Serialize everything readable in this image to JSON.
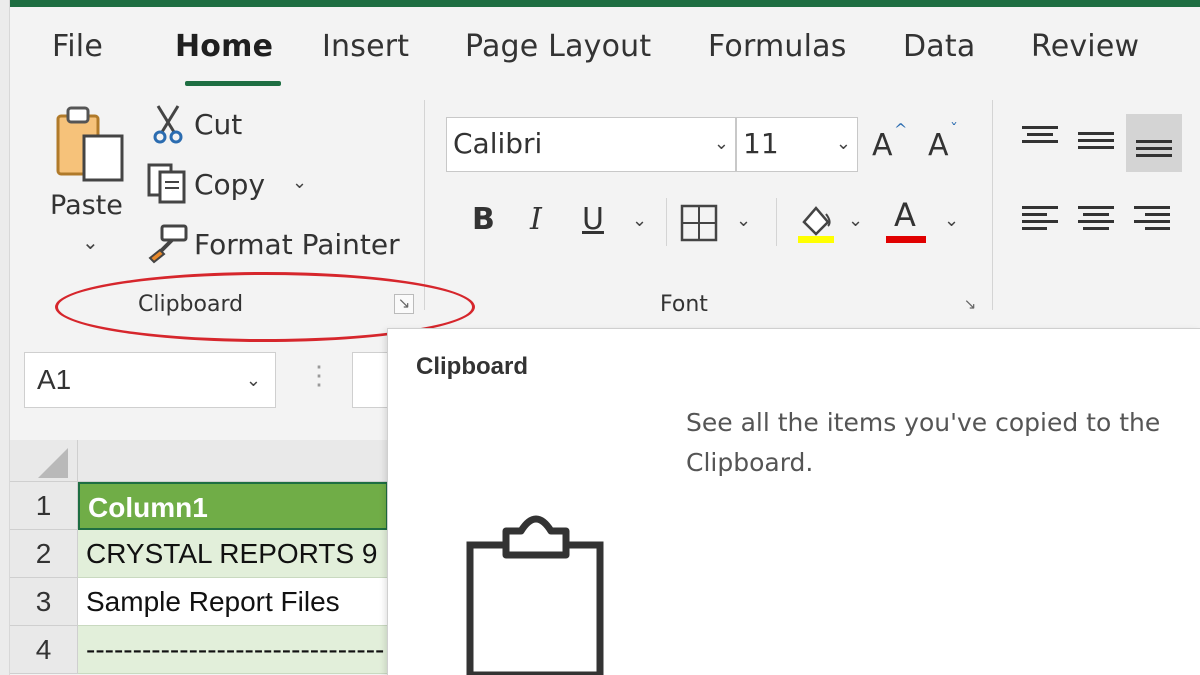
{
  "tabs": [
    "File",
    "Home",
    "Insert",
    "Page Layout",
    "Formulas",
    "Data",
    "Review"
  ],
  "active_tab": "Home",
  "clipboard_group": {
    "paste_label": "Paste",
    "cut_label": "Cut",
    "copy_label": "Copy",
    "format_painter_label": "Format Painter",
    "group_label": "Clipboard"
  },
  "font_group": {
    "font_name": "Calibri",
    "font_size": "11",
    "group_label": "Font",
    "bold": "B",
    "italic": "I",
    "underline": "U",
    "grow_font": "A",
    "shrink_font": "A",
    "font_color_glyph": "A",
    "fill_color": "#ffff00",
    "font_color": "#e00000"
  },
  "name_box": "A1",
  "rows": [
    {
      "num": "1",
      "value": "Column1"
    },
    {
      "num": "2",
      "value": "CRYSTAL REPORTS 9"
    },
    {
      "num": "3",
      "value": "Sample Report Files"
    },
    {
      "num": "4",
      "value": "--------------------------------"
    }
  ],
  "tooltip": {
    "title": "Clipboard",
    "description": "See all the items you've copied to the Clipboard.",
    "icon": "clipboard-icon"
  },
  "colors": {
    "accent": "#1e6e42",
    "header_fill": "#70ad47",
    "band_fill": "#e2efda",
    "annotation": "#d6262c"
  }
}
